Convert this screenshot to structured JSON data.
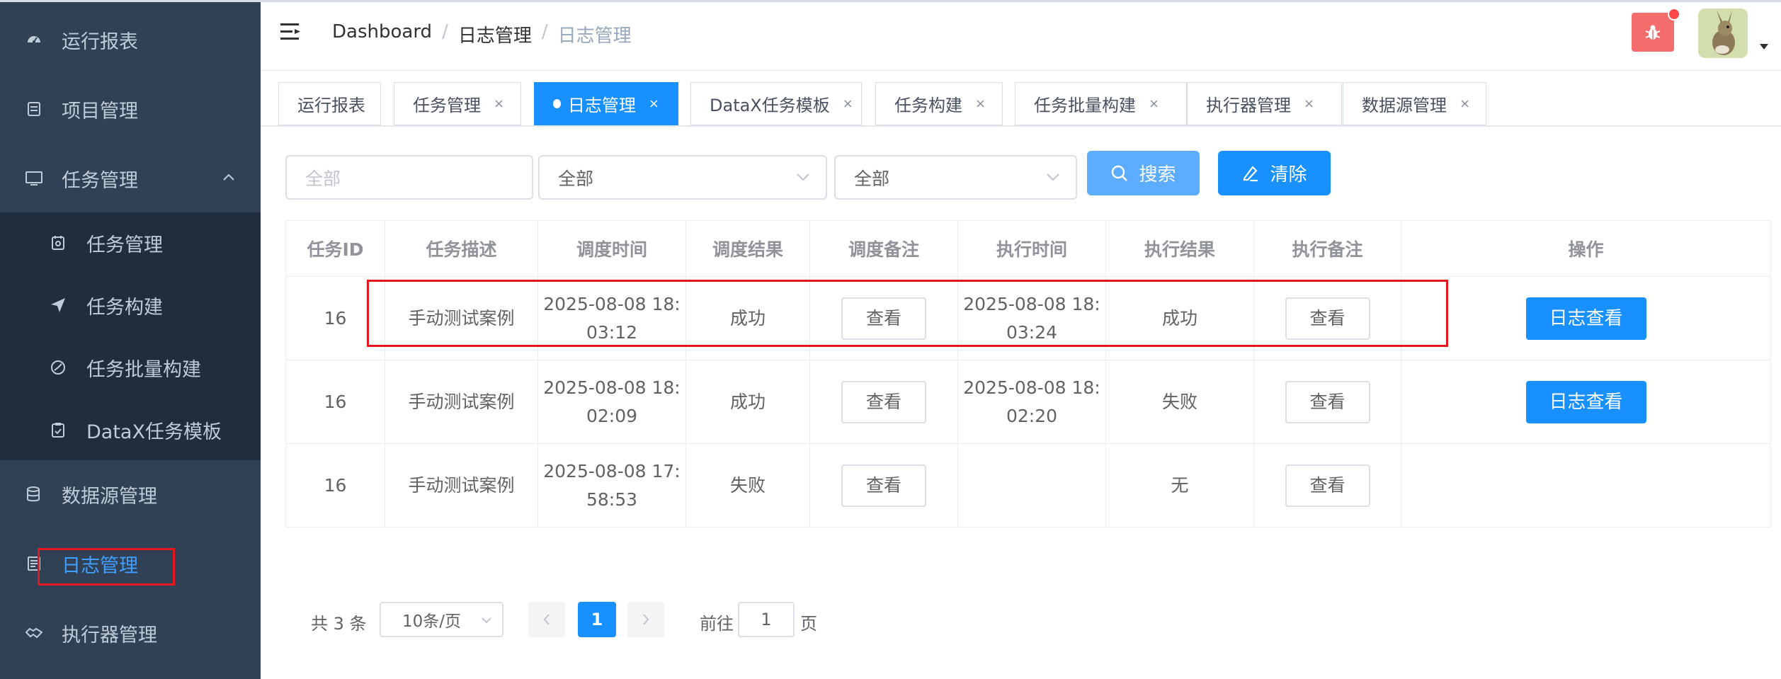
{
  "sidebar": {
    "items": [
      {
        "label": "运行报表",
        "icon": "dashboard-icon"
      },
      {
        "label": "项目管理",
        "icon": "project-icon"
      },
      {
        "label": "任务管理",
        "icon": "monitor-icon"
      },
      {
        "label": "任务管理",
        "icon": "task-icon"
      },
      {
        "label": "任务构建",
        "icon": "send-icon"
      },
      {
        "label": "任务批量构建",
        "icon": "batch-icon"
      },
      {
        "label": "DataX任务模板",
        "icon": "template-icon"
      },
      {
        "label": "数据源管理",
        "icon": "database-icon"
      },
      {
        "label": "日志管理",
        "icon": "log-icon"
      },
      {
        "label": "执行器管理",
        "icon": "handshake-icon"
      }
    ]
  },
  "header": {
    "breadcrumb": [
      "Dashboard",
      "日志管理",
      "日志管理"
    ],
    "separator": "/"
  },
  "tags": [
    {
      "label": "运行报表",
      "closable": false
    },
    {
      "label": "任务管理",
      "closable": true
    },
    {
      "label": "日志管理",
      "closable": true,
      "active": true
    },
    {
      "label": "DataX任务模板",
      "closable": true
    },
    {
      "label": "任务构建",
      "closable": true
    },
    {
      "label": "任务批量构建",
      "closable": true
    },
    {
      "label": "执行器管理",
      "closable": true
    },
    {
      "label": "数据源管理",
      "closable": true
    }
  ],
  "close_glyph": "×",
  "filters": {
    "job_placeholder": "全部",
    "select1": "全部",
    "select2": "全部",
    "search_label": "搜索",
    "clear_label": "清除"
  },
  "table": {
    "columns": [
      "任务ID",
      "任务描述",
      "调度时间",
      "调度结果",
      "调度备注",
      "执行时间",
      "执行结果",
      "执行备注",
      "操作"
    ],
    "rows": [
      {
        "id": "16",
        "desc": "手动测试案例",
        "trigger_time_date": "2025-08-08 18:",
        "trigger_time_time": "03:12",
        "trigger_result": "成功",
        "trigger_note": "查看",
        "handle_time_date": "2025-08-08 18:",
        "handle_time_time": "03:24",
        "handle_result": "成功",
        "handle_note": "查看",
        "action": "日志查看"
      },
      {
        "id": "16",
        "desc": "手动测试案例",
        "trigger_time_date": "2025-08-08 18:",
        "trigger_time_time": "02:09",
        "trigger_result": "成功",
        "trigger_note": "查看",
        "handle_time_date": "2025-08-08 18:",
        "handle_time_time": "02:20",
        "handle_result": "失败",
        "handle_note": "查看",
        "action": "日志查看"
      },
      {
        "id": "16",
        "desc": "手动测试案例",
        "trigger_time_date": "2025-08-08 17:",
        "trigger_time_time": "58:53",
        "trigger_result": "失败",
        "trigger_note": "查看",
        "handle_time_date": "",
        "handle_time_time": "",
        "handle_result": "无",
        "handle_note": "查看",
        "action": ""
      }
    ]
  },
  "pagination": {
    "total": "共 3 条",
    "page_size": "10条/页",
    "current": "1",
    "goto_prefix": "前往",
    "goto_value": "1",
    "goto_suffix": "页"
  },
  "colors": {
    "sidebar_bg": "#304156",
    "submenu_bg": "#1f2d3d",
    "primary": "#1890ff",
    "danger": "#ff0000",
    "highlight_box": "#e5161f"
  }
}
